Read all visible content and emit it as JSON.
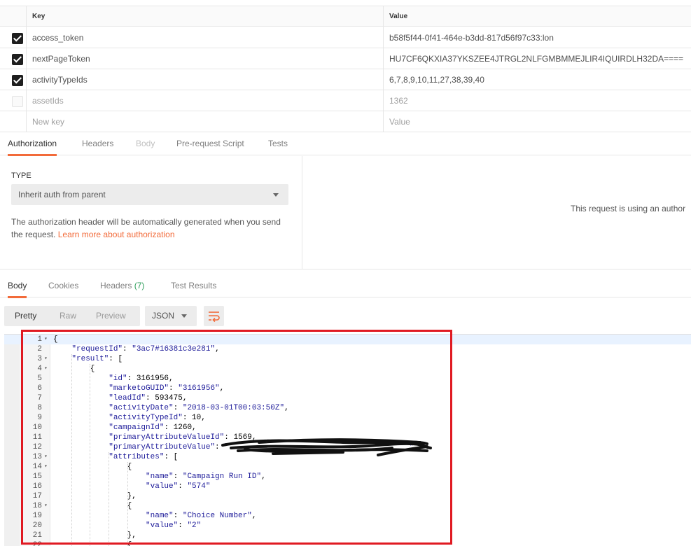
{
  "params": {
    "header": {
      "key": "Key",
      "value": "Value"
    },
    "rows": [
      {
        "key": "access_token",
        "value": "b58f5f44-0f41-464e-b3dd-817d56f97c33:lon",
        "checked": true
      },
      {
        "key": "nextPageToken",
        "value": "HU7CF6QKXIA37YKSZEE4JTRGL2NLFGMBMMEJLIR4IQUIRDLH32DA====",
        "checked": true
      },
      {
        "key": "activityTypeIds",
        "value": "6,7,8,9,10,11,27,38,39,40",
        "checked": true
      },
      {
        "key": "assetIds",
        "value": "1362",
        "checked": false
      }
    ],
    "new_row": {
      "key": "New key",
      "value": "Value"
    }
  },
  "request_tabs": [
    {
      "label": "Authorization",
      "active": true
    },
    {
      "label": "Headers"
    },
    {
      "label": "Body",
      "disabled": true
    },
    {
      "label": "Pre-request Script"
    },
    {
      "label": "Tests"
    }
  ],
  "auth": {
    "type_label": "TYPE",
    "type_value": "Inherit auth from parent",
    "description": "The authorization header will be automatically generated when you send the request.",
    "link": "Learn more about authorization",
    "right_text": "This request is using an author"
  },
  "response_tabs": {
    "body": "Body",
    "cookies": "Cookies",
    "headers": "Headers",
    "headers_count": "(7)",
    "test_results": "Test Results"
  },
  "view_toolbar": {
    "pretty": "Pretty",
    "raw": "Raw",
    "preview": "Preview",
    "format": "JSON"
  },
  "code": {
    "lines": [
      {
        "n": "1",
        "fold": true,
        "t": "{"
      },
      {
        "n": "2",
        "t": "    \"requestId\": \"3ac7#16381c3e281\","
      },
      {
        "n": "3",
        "fold": true,
        "t": "    \"result\": ["
      },
      {
        "n": "4",
        "fold": true,
        "t": "        {"
      },
      {
        "n": "5",
        "t": "            \"id\": 3161956,"
      },
      {
        "n": "6",
        "t": "            \"marketoGUID\": \"3161956\","
      },
      {
        "n": "7",
        "t": "            \"leadId\": 593475,"
      },
      {
        "n": "8",
        "t": "            \"activityDate\": \"2018-03-01T00:03:50Z\","
      },
      {
        "n": "9",
        "t": "            \"activityTypeId\": 10,"
      },
      {
        "n": "10",
        "t": "            \"campaignId\": 1260,"
      },
      {
        "n": "11",
        "t": "            \"primaryAttributeValueId\": 1569,"
      },
      {
        "n": "12",
        "t": "            \"primaryAttributeValue\": \"                                       \","
      },
      {
        "n": "13",
        "fold": true,
        "t": "            \"attributes\": ["
      },
      {
        "n": "14",
        "fold": true,
        "t": "                {"
      },
      {
        "n": "15",
        "t": "                    \"name\": \"Campaign Run ID\","
      },
      {
        "n": "16",
        "t": "                    \"value\": \"574\""
      },
      {
        "n": "17",
        "t": "                },"
      },
      {
        "n": "18",
        "fold": true,
        "t": "                {"
      },
      {
        "n": "19",
        "t": "                    \"name\": \"Choice Number\","
      },
      {
        "n": "20",
        "t": "                    \"value\": \"2\""
      },
      {
        "n": "21",
        "t": "                },"
      },
      {
        "n": "22",
        "t": "                {"
      }
    ]
  },
  "colors": {
    "accent": "#f26b3a",
    "highlight_box": "#e01a22",
    "count": "#2e9e5b"
  }
}
